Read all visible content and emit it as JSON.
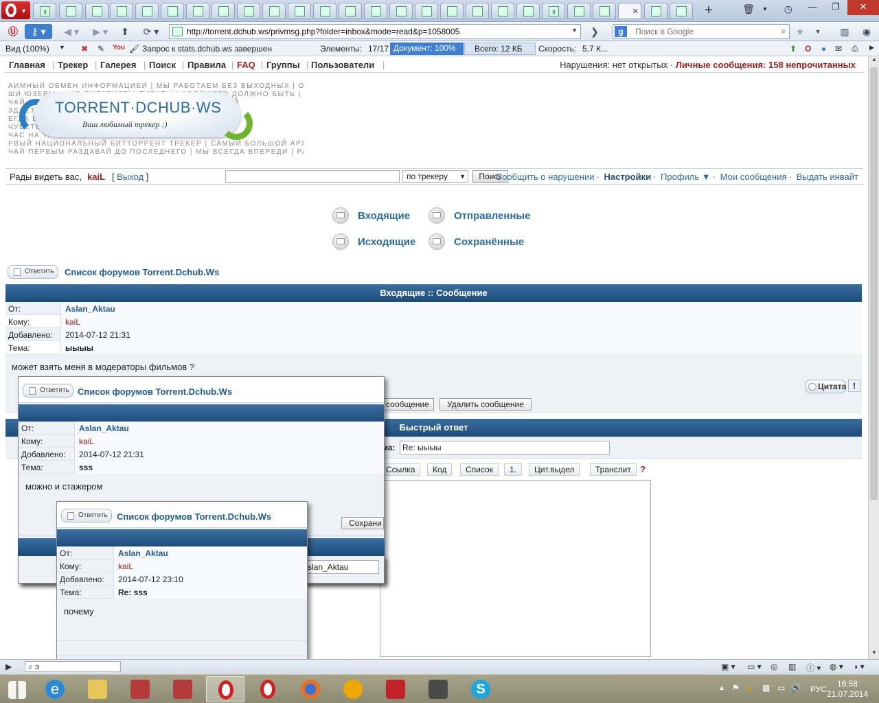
{
  "browser": {
    "url": "http://torrent.dchub.ws/privmsg.php?folder=inbox&mode=read&p=1058005",
    "search_placeholder": "Поиск в Google",
    "status": {
      "zoom": "Вид (100%)",
      "request": "Запрос к stats.dchub.ws завершен",
      "elements_label": "Элементы:",
      "elements": "17/17",
      "document": "Документ:  100%",
      "total": "Всего:   12 КБ",
      "speed_label": "Скорость:",
      "speed": "5,7 К..."
    },
    "bottom_find": "э"
  },
  "site": {
    "menu": [
      "Главная",
      "Трекер",
      "Галерея",
      "Поиск",
      "Правила",
      "FAQ",
      "Группы",
      "Пользователи"
    ],
    "violations": "Нарушения: нет открытых",
    "pm_label": "Личные сообщения:",
    "pm_count": "158",
    "pm_unread": "непрочитанных",
    "logo_title": "TORRENT·DCHUB·WS",
    "logo_subtitle": "Ваш любимый трекер :)",
    "banner_lines": [
      "АИМНЫЙ ОБМЕН ИНФОРМАЦИЕЙ | МЫ РАБОТАЕМ БЕЗ ВЫХОДНЫХ | ОПС",
      "ШИ ЮЗЕРЫ — НЕ ПИРАТИСТЫ ПИРАТЫ | ХОРОШЕГО ДОЛЖНО БЫТЬ |",
      "ЧАЙ С ВАМИ ВЕДЁТ ТРЕКЕР ДЛЯ ТЕБЯ | ТЕБЯ УКАЧАЙ",
      "ЗДАЁТСЯ ДЛЯ ВАС ВСЁ ЛУЧШЕЕ | ВСЕГДА КАЧАЮТ",
      "ЕГДА ВСЁ СВЕЖЕЕ | МЫ ВСЕГДА СВЕЖ",
      "ЧУВСТВУЙ СЕБЯ КАК ДОМА | ЧУВСТВУЙ",
      "ЧАС НА ТРЕКЕРЕ | МЫ С ВАМИ | У Н",
      "РВЫЙ НАЦИОНАЛЬНЫЙ БИТТОРРЕНТ ТРЕКЕР | САМЫЙ БОЛЬШОЙ АРХИ",
      "ЧАЙ ПЕРВЫМ РАЗДАВАЙ ДО ПОСЛЕДНЕГО | МЫ ВСЕГДА ВПЕРЕДИ | РАЗД"
    ]
  },
  "userbar": {
    "greeting": "Рады видеть вас,",
    "username": "kaiL",
    "logout": "Выход",
    "search_scope": "по трекеру",
    "search_button": "Поиск",
    "links": [
      "Сообщить о нарушении",
      "Настройки",
      "Профиль ▼",
      "Мои сообщения",
      "Выдать инвайт"
    ]
  },
  "pm_nav": {
    "inbox": "Входящие",
    "sent": "Отправленные",
    "outbox": "Исходящие",
    "saved": "Сохранённые"
  },
  "message": {
    "reply_btn": "Ответить",
    "forum_link": "Список форумов Torrent.Dchub.Ws",
    "header": "Входящие :: Сообщение",
    "labels": {
      "from": "От:",
      "to": "Кому:",
      "added": "Добавлено:",
      "subject": "Тема:"
    },
    "from": "Aslan_Aktau",
    "to": "kaiL",
    "added": "2014-07-12 21:31",
    "subject": "ыыыы",
    "body": "может взять меня в модераторы фильмов ?",
    "quote_btn": "Цитата",
    "save_btn": "сообщение",
    "delete_btn": "Удалить сообщение"
  },
  "quick_reply": {
    "header": "Быстрый ответ",
    "subject_label": "ма:",
    "subject_value": "Re: ыыыы",
    "toolbar": [
      "Ссылка",
      "Код",
      "Список",
      "1.",
      "Цит.выдел",
      "Транслит"
    ],
    "help": "?"
  },
  "popup1": {
    "reply_btn": "Ответить",
    "forum_link": "Список форумов Torrent.Dchub.Ws",
    "from": "Aslan_Aktau",
    "to": "kaiL",
    "added": "2014-07-12 21:31",
    "subject": "sss",
    "body": "можно и стажером",
    "save_btn": "Сохрани",
    "recipient_field": "slan_Aktau"
  },
  "popup2": {
    "reply_btn": "Ответить",
    "forum_link": "Список форумов Torrent.Dchub.Ws",
    "from": "Aslan_Aktau",
    "to": "kaiL",
    "added": "2014-07-12 23:10",
    "subject": "Re: sss",
    "body": "почему"
  },
  "taskbar": {
    "lang": "РУС",
    "time": "16:58",
    "date": "21.07.2014"
  },
  "colors": {
    "accent_blue": "#1f5d94",
    "header_bar": "#1b4b7b",
    "alert_red": "#a02020"
  }
}
